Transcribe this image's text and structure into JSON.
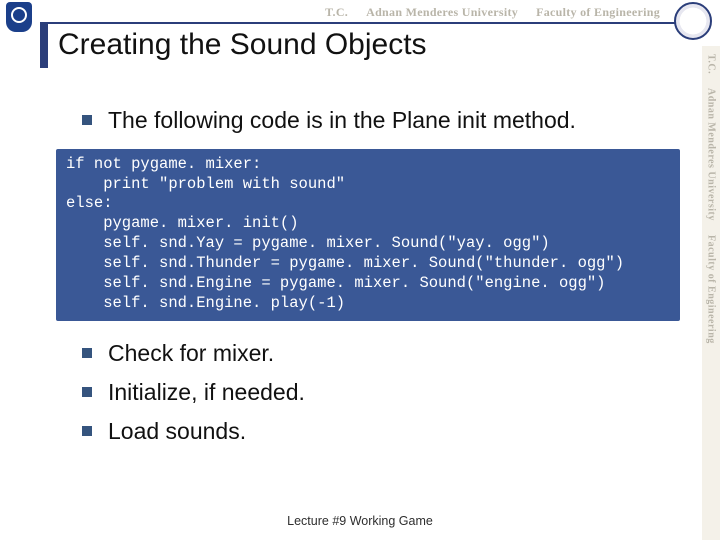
{
  "header": {
    "segments": [
      "T.C.",
      "Adnan Menderes University",
      "Faculty of Engineering"
    ]
  },
  "sideband": {
    "segments": [
      "T.C.",
      "Adnan Menderes University",
      "Faculty of Engineering"
    ]
  },
  "title": "Creating the Sound Objects",
  "bullets_top": [
    "The following code is in the Plane init method."
  ],
  "code": "if not pygame. mixer:\n    print \"problem with sound\"\nelse:\n    pygame. mixer. init()\n    self. snd.Yay = pygame. mixer. Sound(\"yay. ogg\")\n    self. snd.Thunder = pygame. mixer. Sound(\"thunder. ogg\")\n    self. snd.Engine = pygame. mixer. Sound(\"engine. ogg\")\n    self. snd.Engine. play(-1)",
  "bullets_bottom": [
    "Check for mixer.",
    "Initialize, if needed.",
    "Load sounds."
  ],
  "footer": "Lecture #9 Working Game"
}
